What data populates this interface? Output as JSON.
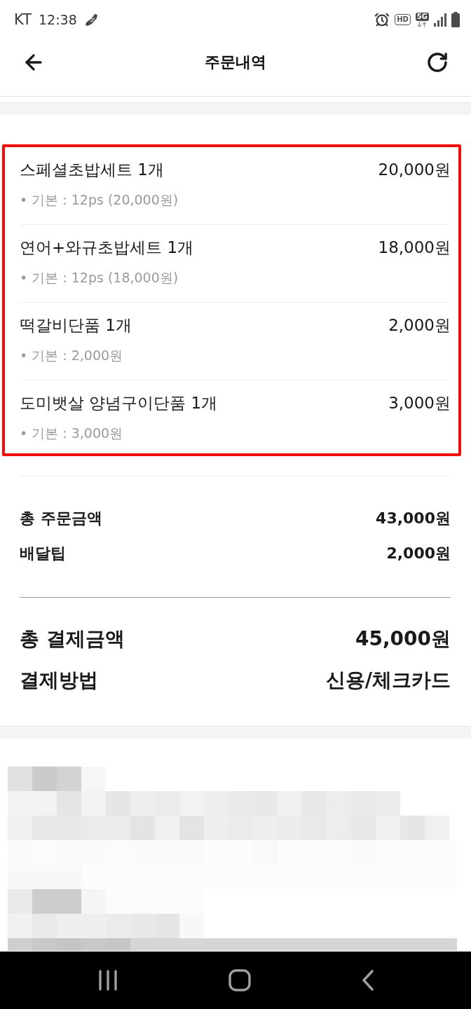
{
  "status_bar": {
    "carrier": "KT",
    "time": "12:38",
    "hd_label": "HD",
    "network_label": "5G"
  },
  "header": {
    "title": "주문내역"
  },
  "items": [
    {
      "name": "스페셜초밥세트 1개",
      "price": "20,000원",
      "option": "• 기본 : 12ps (20,000원)"
    },
    {
      "name": "연어+와규초밥세트 1개",
      "price": "18,000원",
      "option": "• 기본 : 12ps (18,000원)"
    },
    {
      "name": "떡갈비단품 1개",
      "price": "2,000원",
      "option": "• 기본 : 2,000원"
    },
    {
      "name": "도미뱃살 양념구이단품 1개",
      "price": "3,000원",
      "option": "• 기본 : 3,000원"
    }
  ],
  "summary": [
    {
      "label": "총 주문금액",
      "value": "43,000원"
    },
    {
      "label": "배달팁",
      "value": "2,000원"
    }
  ],
  "payment": [
    {
      "label": "총 결제금액",
      "value": "45,000원"
    },
    {
      "label": "결제방법",
      "value": "신용/체크카드"
    }
  ]
}
